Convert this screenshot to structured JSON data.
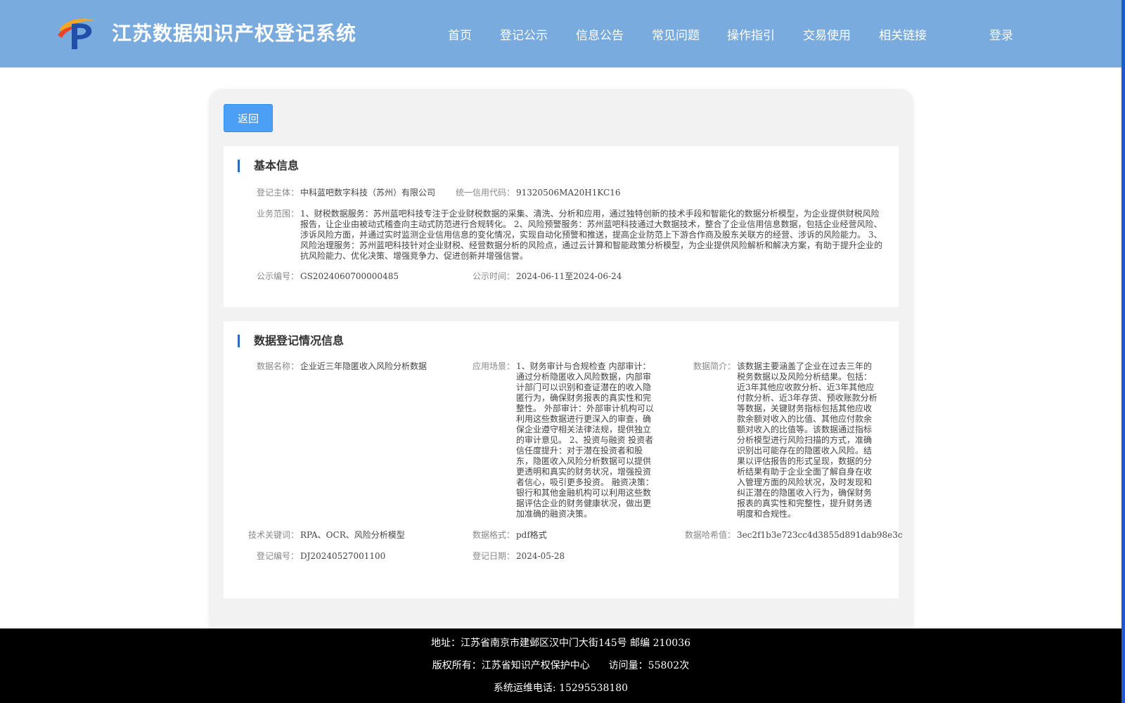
{
  "header": {
    "site_title": "江苏数据知识产权登记系统",
    "nav": [
      "首页",
      "登记公示",
      "信息公告",
      "常见问题",
      "操作指引",
      "交易使用",
      "相关链接"
    ],
    "login": "登录"
  },
  "back_button": "返回",
  "basic_info": {
    "title": "基本信息",
    "subject_label": "登记主体：",
    "subject_value": "中科蓝吧数字科技（苏州）有限公司",
    "credit_code_label": "统一信用代码：",
    "credit_code_value": "91320506MA20H1KC16",
    "scope_label": "业务范围：",
    "scope_value": "1、财税数据服务：苏州蓝吧科技专注于企业财税数据的采集、清洗、分析和应用，通过独特创新的技术手段和智能化的数据分析模型，为企业提供财税风险报告，让企业由被动式稽查向主动式防范进行合规转化。 2、风险预警服务：苏州蓝吧科技通过大数据技术，整合了企业信用信息数据，包括企业经营风险、涉诉风险方面，并通过实时监测企业信用信息的变化情况，实现自动化预警和推送，提高企业防范上下游合作商及股东关联方的经营、涉诉的风险能力。 3、风险治理服务：苏州蓝吧科技针对企业财税、经营数据分析的风险点，通过云计算和智能政策分析模型，为企业提供风险解析和解决方案，有助于提升企业的抗风险能力、优化决策、增强竞争力、促进创新并增强信誉。",
    "pub_no_label": "公示编号：",
    "pub_no_value": "GS2024060700000485",
    "pub_time_label": "公示时间：",
    "pub_time_value": "2024-06-11至2024-06-24"
  },
  "data_info": {
    "title": "数据登记情况信息",
    "name_label": "数据名称：",
    "name_value": "企业近三年隐匿收入风险分析数据",
    "scene_label": "应用场景：",
    "scene_value": "1、财务审计与合规检查 内部审计：通过分析隐匿收入风险数据，内部审计部门可以识别和查证潜在的收入隐匿行为，确保财务报表的真实性和完整性。 外部审计：外部审计机构可以利用这些数据进行更深入的审查，确保企业遵守相关法律法规，提供独立的审计意见。 2、投资与融资 投资者信任度提升：对于潜在投资者和股东，隐匿收入风险分析数据可以提供更透明和真实的财务状况，增强投资者信心，吸引更多投资。 融资决策：银行和其他金融机构可以利用这些数据评估企业的财务健康状况，做出更加准确的融资决策。",
    "intro_label": "数据简介：",
    "intro_value": "该数据主要涵盖了企业在过去三年的税务数据以及风险分析结果。包括：近3年其他应收款分析、近3年其他应付款分析、近3年存货、预收账款分析等数据，关键财务指标包括其他应收款余额对收入的比值、其他应付款余额对收入的比值等。该数据通过指标分析模型进行风险扫描的方式，准确识别出可能存在的隐匿收入风险。结果以评估报告的形式呈现，数据的分析结果有助于企业全面了解自身在收入管理方面的风险状况，及时发现和纠正潜在的隐匿收入行为，确保财务报表的真实性和完整性，提升财务透明度和合规性。",
    "keywords_label": "技术关键词：",
    "keywords_value": "RPA、OCR、风险分析模型",
    "format_label": "数据格式：",
    "format_value": "pdf格式",
    "hash_label": "数据哈希值：",
    "hash_value": "3ec2f1b3e723cc4d3855d891dab98e3c",
    "reg_no_label": "登记编号：",
    "reg_no_value": "DJ20240527001100",
    "reg_date_label": "登记日期：",
    "reg_date_value": "2024-05-28"
  },
  "footer": {
    "address": "地址：江苏省南京市建邺区汉中门大街145号 邮编 210036",
    "copyright": "版权所有：江苏省知识产权保护中心",
    "visits": "访问量：55802次",
    "phone": "系统运维电话: 15295538180"
  },
  "colors": {
    "header_bg": "#7aabde",
    "button_blue": "#4b9ff5",
    "section_bar": "#2f6bb8",
    "footer_bg": "#000000"
  }
}
